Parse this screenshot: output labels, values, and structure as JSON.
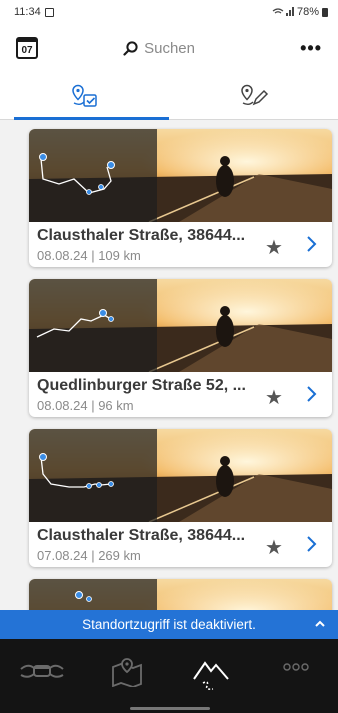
{
  "status_bar": {
    "time": "11:34",
    "battery": "78%"
  },
  "top_bar": {
    "calendar_day": "07",
    "search_placeholder": "Suchen",
    "more": "•••"
  },
  "tabs": [
    {
      "name": "planned-routes",
      "active": true
    },
    {
      "name": "edit-routes",
      "active": false
    }
  ],
  "routes": [
    {
      "title": "Clausthaler Straße, 38644...",
      "meta": "08.08.24 | 109 km"
    },
    {
      "title": "Quedlinburger Straße 52, ...",
      "meta": "08.08.24 | 96 km"
    },
    {
      "title": "Clausthaler Straße, 38644...",
      "meta": "07.08.24 | 269 km"
    }
  ],
  "banner": {
    "text": "Standortzugriff ist deaktiviert."
  },
  "bottom_nav": [
    {
      "icon": "motorcycle-handlebar-icon",
      "active": false
    },
    {
      "icon": "map-pin-icon",
      "active": false
    },
    {
      "icon": "mountain-route-icon",
      "active": true
    },
    {
      "icon": "more-dots-icon",
      "active": false
    }
  ],
  "colors": {
    "accent": "#1a6fd4",
    "banner": "#2473d6",
    "nav_bg": "#141414"
  }
}
